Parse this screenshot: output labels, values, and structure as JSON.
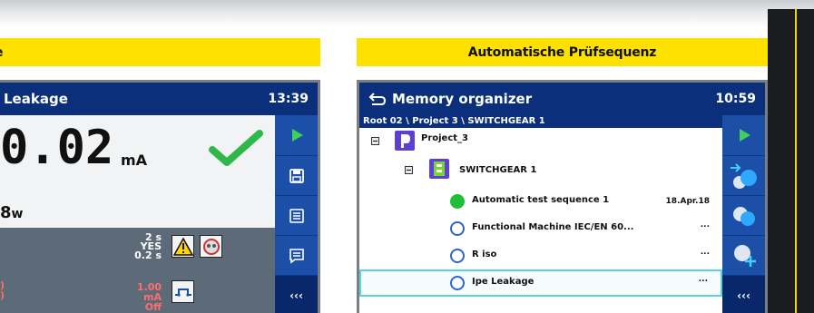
{
  "left_panel": {
    "banner_label": "e",
    "screen": {
      "title": "Leakage",
      "time": "13:39",
      "main_value": "0.02",
      "main_unit": "mA",
      "sub_value": "8",
      "sub_unit": "w",
      "params": {
        "duration": "2 s",
        "enabled": "YES",
        "step": "0.2 s",
        "limit": "1.00 mA",
        "state": "Off",
        "left_red_1": ")",
        "left_red_2": ")"
      },
      "sidebar": [
        {
          "icon": "play-icon"
        },
        {
          "icon": "save-icon"
        },
        {
          "icon": "list-icon"
        },
        {
          "icon": "comment-icon"
        },
        {
          "icon": "back-arrows-icon",
          "label": "‹‹‹"
        }
      ]
    }
  },
  "right_panel": {
    "banner_label": "Automatische Prüfsequenz",
    "screen": {
      "title": "Memory organizer",
      "time": "10:59",
      "breadcrumb": "Root 02 \\ Project 3 \\ SWITCHGEAR 1",
      "tree": [
        {
          "label": "Project_3",
          "type": "project"
        },
        {
          "label": "SWITCHGEAR 1",
          "type": "switchgear"
        },
        {
          "label": "Automatic test sequence 1",
          "status": "done",
          "meta": "18.Apr.18"
        },
        {
          "label": "Functional Machine IEC/EN 60...",
          "status": "open",
          "meta": "..."
        },
        {
          "label": "R iso",
          "status": "open",
          "meta": "..."
        },
        {
          "label": "Ipe Leakage",
          "status": "open",
          "meta": "...",
          "selected": true
        }
      ],
      "sidebar": [
        {
          "icon": "play-icon"
        },
        {
          "icon": "start-sequence-icon"
        },
        {
          "icon": "clone-icon"
        },
        {
          "icon": "add-item-icon"
        },
        {
          "icon": "back-arrows-icon",
          "label": "‹‹‹"
        }
      ]
    }
  },
  "colors": {
    "banner": "#ffe100",
    "title_bar": "#0b2f7a",
    "sidebar": "#1b4fa8",
    "pass_green": "#2fb84a",
    "fail_red": "#ff6d6d",
    "selection": "#59d4e2"
  }
}
